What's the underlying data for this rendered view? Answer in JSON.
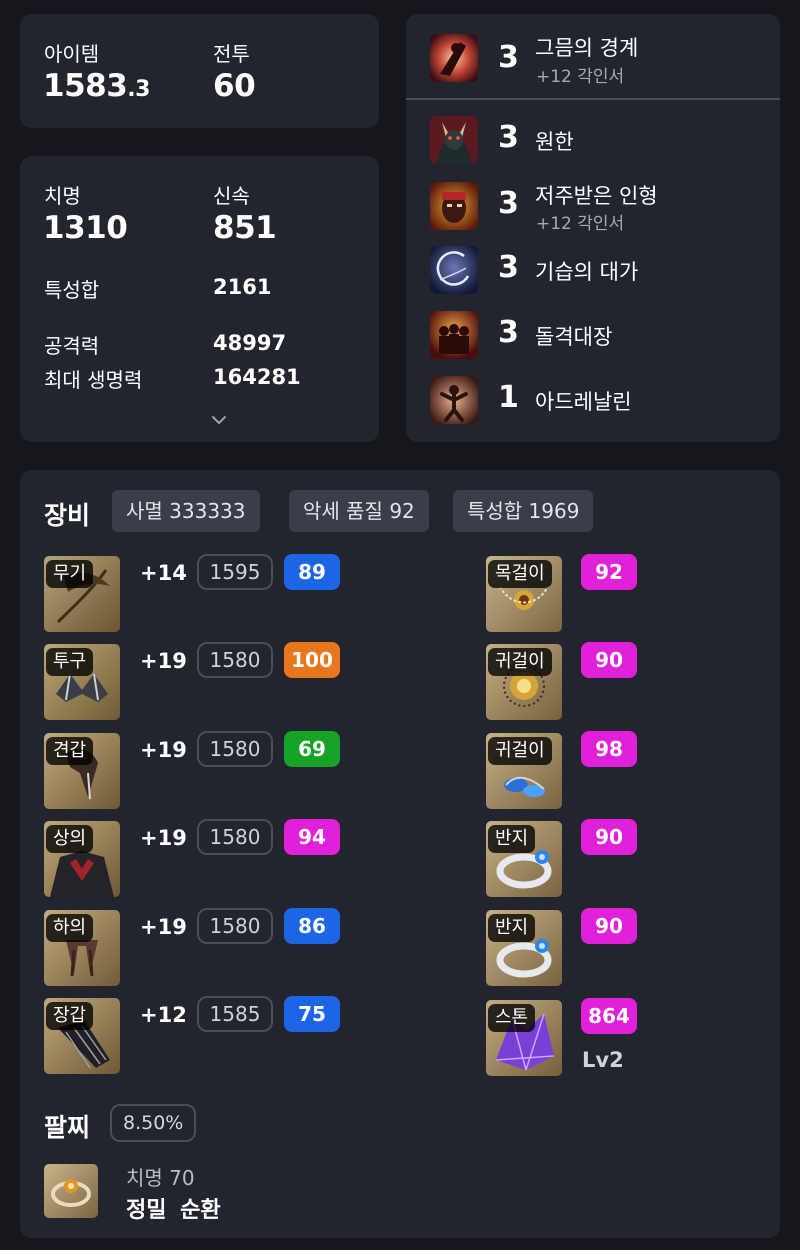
{
  "summary": {
    "item_level_label": "아이템",
    "item_level_main": "1583",
    "item_level_decimal": ".3",
    "combat_label": "전투",
    "combat_value": "60"
  },
  "stats": {
    "crit_label": "치명",
    "crit_value": "1310",
    "swift_label": "신속",
    "swift_value": "851",
    "total_label": "특성합",
    "total_value": "2161",
    "attack_label": "공격력",
    "attack_value": "48997",
    "hp_label": "최대 생명력",
    "hp_value": "164281",
    "expand_icon": "chevron-down-icon"
  },
  "engravings": [
    {
      "level": "3",
      "name": "그믐의 경계",
      "sub": "+12 각인서",
      "icon": "grudge-shadow-icon"
    },
    {
      "level": "3",
      "name": "원한",
      "sub": "",
      "icon": "demon-icon"
    },
    {
      "level": "3",
      "name": "저주받은 인형",
      "sub": "+12 각인서",
      "icon": "cursed-doll-icon"
    },
    {
      "level": "3",
      "name": "기습의 대가",
      "sub": "",
      "icon": "ambush-icon"
    },
    {
      "level": "3",
      "name": "돌격대장",
      "sub": "",
      "icon": "raid-captain-icon"
    },
    {
      "level": "1",
      "name": "아드레날린",
      "sub": "",
      "icon": "adrenaline-icon"
    }
  ],
  "equipment": {
    "title": "장비",
    "chips": [
      "사멸 333333",
      "악세 품질 92",
      "특성합 1969"
    ],
    "gear": [
      {
        "tag": "무기",
        "plus": "+14",
        "level": "1595",
        "quality": "89",
        "qcolor": "#1c66e6"
      },
      {
        "tag": "투구",
        "plus": "+19",
        "level": "1580",
        "quality": "100",
        "qcolor": "#e8761c"
      },
      {
        "tag": "견갑",
        "plus": "+19",
        "level": "1580",
        "quality": "69",
        "qcolor": "#17a327"
      },
      {
        "tag": "상의",
        "plus": "+19",
        "level": "1580",
        "quality": "94",
        "qcolor": "#e021d9"
      },
      {
        "tag": "하의",
        "plus": "+19",
        "level": "1580",
        "quality": "86",
        "qcolor": "#1c66e6"
      },
      {
        "tag": "장갑",
        "plus": "+12",
        "level": "1585",
        "quality": "75",
        "qcolor": "#1c66e6"
      }
    ],
    "accessories": [
      {
        "tag": "목걸이",
        "quality": "92"
      },
      {
        "tag": "귀걸이",
        "quality": "90"
      },
      {
        "tag": "귀걸이",
        "quality": "98"
      },
      {
        "tag": "반지",
        "quality": "90"
      },
      {
        "tag": "반지",
        "quality": "90"
      },
      {
        "tag": "스톤",
        "quality": "864",
        "extra": "Lv2"
      }
    ],
    "bracelet": {
      "title": "팔찌",
      "percent": "8.50%",
      "line1": "치명 70",
      "line2": "정밀 순환"
    }
  }
}
